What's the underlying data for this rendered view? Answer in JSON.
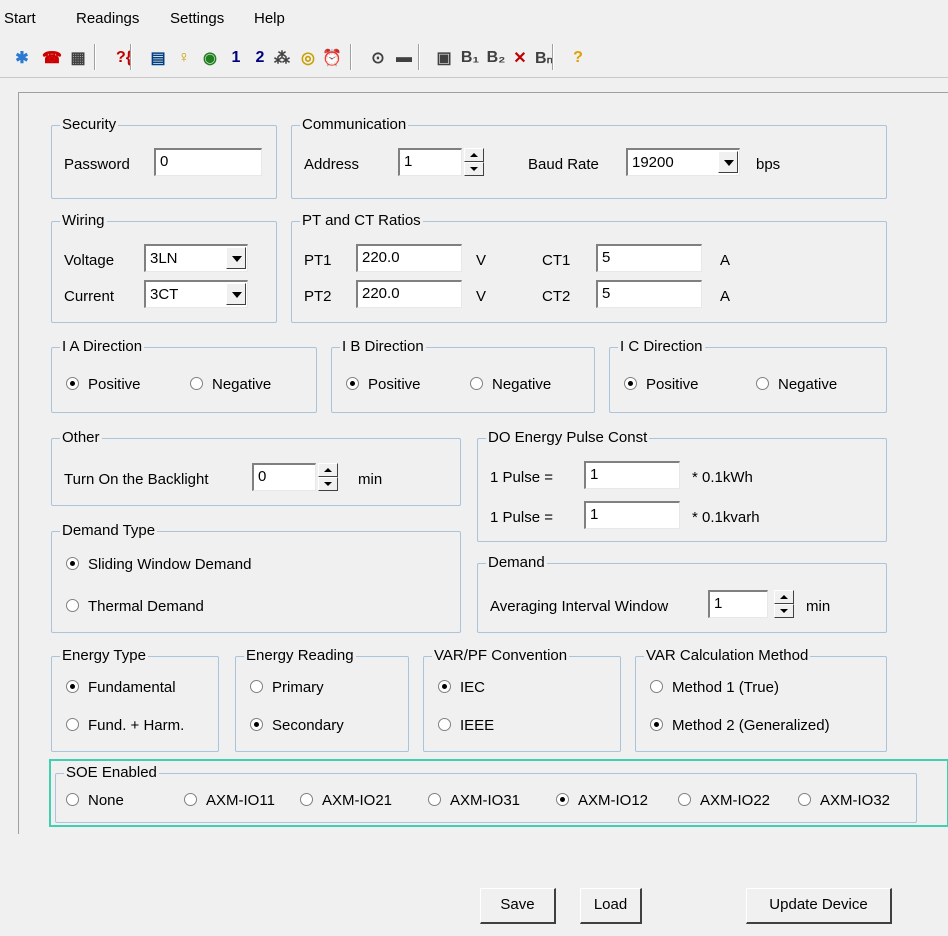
{
  "menu": [
    "Start",
    "Readings",
    "Settings",
    "Help"
  ],
  "toolbar": {
    "icons": [
      {
        "name": "connect-icon",
        "glyph": "✱",
        "color": "#2a7ad0"
      },
      {
        "name": "phone-icon",
        "glyph": "☎",
        "color": "#cc0000"
      },
      {
        "name": "device-icon",
        "glyph": "▦",
        "color": "#404040"
      },
      {
        "name": "query-icon",
        "glyph": "?{",
        "color": "#c00000"
      },
      {
        "name": "meter-icon",
        "glyph": "▤",
        "color": "#004080"
      },
      {
        "name": "key-icon",
        "glyph": "♀",
        "color": "#c8a000"
      },
      {
        "name": "globe-icon",
        "glyph": "◉",
        "color": "#208020"
      },
      {
        "name": "channel-1-icon",
        "glyph": "1",
        "color": "#000080"
      },
      {
        "name": "channel-2-icon",
        "glyph": "2",
        "color": "#000080"
      },
      {
        "name": "io-icon",
        "glyph": "⁂",
        "color": "#404040"
      },
      {
        "name": "target-icon",
        "glyph": "◎",
        "color": "#c8a000"
      },
      {
        "name": "alarm-clock-icon",
        "glyph": "⏰",
        "color": "#c00000"
      },
      {
        "name": "clock-icon",
        "glyph": "⊙",
        "color": "#404040"
      },
      {
        "name": "memory-icon",
        "glyph": "▬",
        "color": "#404040"
      },
      {
        "name": "report-icon",
        "glyph": "▣",
        "color": "#404040"
      },
      {
        "name": "doc-1-icon",
        "glyph": "B₁",
        "color": "#404040"
      },
      {
        "name": "doc-2-icon",
        "glyph": "B₂",
        "color": "#404040"
      },
      {
        "name": "doc-delete-icon",
        "glyph": "✕",
        "color": "#c00000"
      },
      {
        "name": "doc-n-icon",
        "glyph": "Bₙ",
        "color": "#404040"
      },
      {
        "name": "help-icon",
        "glyph": "?",
        "color": "#e0a000"
      }
    ]
  },
  "security": {
    "title": "Security",
    "password_label": "Password",
    "password_value": "0"
  },
  "communication": {
    "title": "Communication",
    "address_label": "Address",
    "address_value": "1",
    "baud_label": "Baud Rate",
    "baud_value": "19200",
    "baud_unit": "bps"
  },
  "wiring": {
    "title": "Wiring",
    "voltage_label": "Voltage",
    "voltage_value": "3LN",
    "current_label": "Current",
    "current_value": "3CT"
  },
  "ratios": {
    "title": "PT and CT Ratios",
    "pt1_label": "PT1",
    "pt1_value": "220.0",
    "pt2_label": "PT2",
    "pt2_value": "220.0",
    "v_unit": "V",
    "ct1_label": "CT1",
    "ct1_value": "5",
    "ct2_label": "CT2",
    "ct2_value": "5",
    "a_unit": "A"
  },
  "ia": {
    "title": "I A Direction",
    "positive": "Positive",
    "negative": "Negative"
  },
  "ib": {
    "title": "I B Direction",
    "positive": "Positive",
    "negative": "Negative"
  },
  "ic": {
    "title": "I C Direction",
    "positive": "Positive",
    "negative": "Negative"
  },
  "other": {
    "title": "Other",
    "backlight_label": "Turn On the Backlight",
    "backlight_value": "0",
    "unit": "min"
  },
  "pulse": {
    "title": "DO Energy Pulse Const",
    "label1": "1 Pulse =",
    "value1": "1",
    "unit1": "* 0.1kWh",
    "label2": "1 Pulse =",
    "value2": "1",
    "unit2": "* 0.1kvarh"
  },
  "demand_type": {
    "title": "Demand Type",
    "sliding": "Sliding Window Demand",
    "thermal": "Thermal Demand"
  },
  "demand": {
    "title": "Demand",
    "interval_label": "Averaging Interval Window",
    "interval_value": "1",
    "unit": "min"
  },
  "energy_type": {
    "title": "Energy Type",
    "fundamental": "Fundamental",
    "harm": "Fund. + Harm."
  },
  "energy_reading": {
    "title": "Energy Reading",
    "primary": "Primary",
    "secondary": "Secondary"
  },
  "varpf": {
    "title": "VAR/PF Convention",
    "iec": "IEC",
    "ieee": "IEEE"
  },
  "varcalc": {
    "title": "VAR Calculation Method",
    "m1": "Method 1 (True)",
    "m2": "Method 2 (Generalized)"
  },
  "soe": {
    "title": "SOE Enabled",
    "none": "None",
    "o1": "AXM-IO11",
    "o2": "AXM-IO21",
    "o3": "AXM-IO31",
    "o4": "AXM-IO12",
    "o5": "AXM-IO22",
    "o6": "AXM-IO32",
    "highlight_color": "#40d0b0"
  },
  "buttons": {
    "save": "Save",
    "load": "Load",
    "update": "Update Device"
  }
}
